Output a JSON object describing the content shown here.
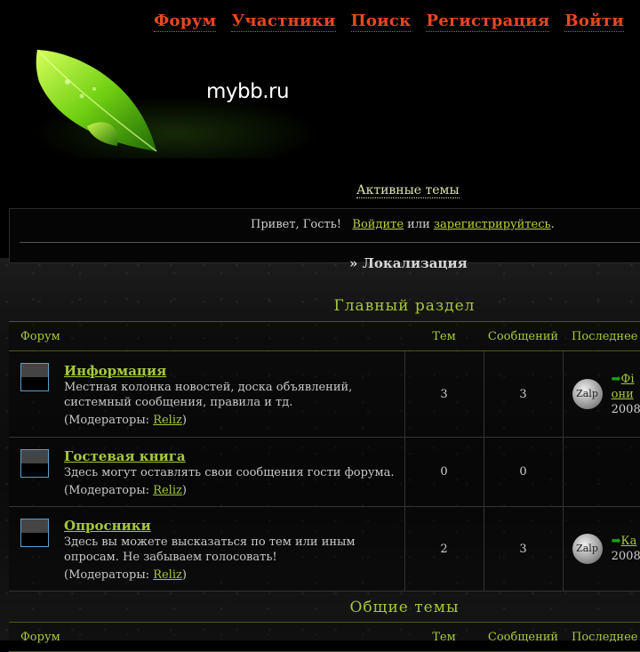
{
  "topnav": [
    "Форум",
    "Участники",
    "Поиск",
    "Регистрация",
    "Войти"
  ],
  "logo": {
    "text": "mybb.ru"
  },
  "active_topics": "Активные темы",
  "greeting": {
    "hello": "Привет, Гость!",
    "login_link": "Войдите",
    "or": "или",
    "register_link": "зарегистрируйтесь",
    "dot": "."
  },
  "localization": "» Локализация",
  "columns": {
    "forum": "Форум",
    "topics": "Тем",
    "posts": "Сообщений",
    "last": "Последнее"
  },
  "categories": [
    {
      "title": "Главный раздел",
      "forums": [
        {
          "name": "Информация",
          "desc": "Местная колонка новостей, доска объявлений, системный сообщения, правила и тд.",
          "mods_prefix": "(Модераторы: ",
          "mod": "Reliz",
          "mods_suffix": ")",
          "topics": "3",
          "posts": "3",
          "last": {
            "avatar": "Zalp",
            "link": "Фі",
            "line2": "они",
            "line3": "2008"
          }
        },
        {
          "name": "Гостевая книга",
          "desc": "Здесь могут оставлять свои сообщения гости форума.",
          "mods_prefix": "(Модераторы: ",
          "mod": "Reliz",
          "mods_suffix": ")",
          "topics": "0",
          "posts": "0",
          "last": null
        },
        {
          "name": "Опросники",
          "desc": "Здесь вы можете высказаться по тем или иным опросам. Не забываем голосовать!",
          "mods_prefix": "(Модераторы: ",
          "mod": "Reliz",
          "mods_suffix": ")",
          "topics": "2",
          "posts": "3",
          "last": {
            "avatar": "Zalp",
            "link": "Ка",
            "line2": "",
            "line3": "2008"
          }
        }
      ]
    },
    {
      "title": "Общие темы"
    }
  ],
  "colors": {
    "nav": "#e8481e",
    "accent": "#a6c83a",
    "background": "#000000"
  }
}
